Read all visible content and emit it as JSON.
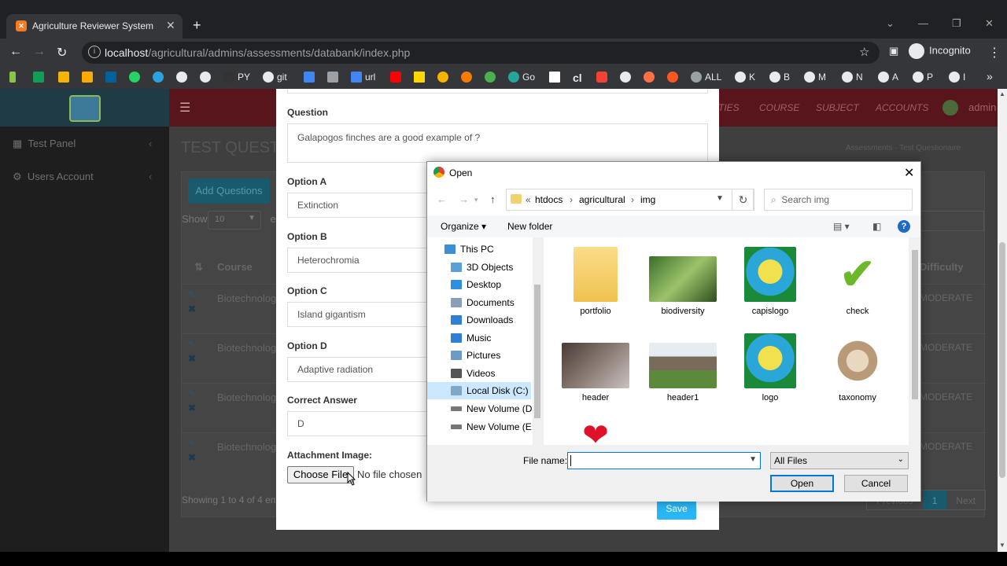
{
  "browser": {
    "tab_title": "Agriculture Reviewer System",
    "new_tab": "+",
    "url_host": "localhost",
    "url_path": "/agricultural/admins/assessments/databank/index.php",
    "incognito_label": "Incognito",
    "bookmarks": [
      "PY",
      "git",
      "url",
      "Go",
      "cl",
      "ALL",
      "K",
      "B",
      "M",
      "N",
      "A",
      "P",
      "I"
    ],
    "more_bookmarks": "»"
  },
  "sidebar": {
    "items": [
      {
        "label": "Test Panel"
      },
      {
        "label": "Users Account"
      }
    ]
  },
  "topnav": {
    "items": [
      "TIES",
      "COURSE",
      "SUBJECT",
      "ACCOUNTS"
    ],
    "user": "admin"
  },
  "content": {
    "title": "TEST QUESTI",
    "breadcrumb": "Assessments  ·  Test Questionaire",
    "add_button": "Add Questions",
    "show_label": "Show",
    "entries_value": "10",
    "entries_suffix": "en",
    "columns": {
      "course": "Course",
      "difficulty": "Difficulty"
    },
    "rows": [
      {
        "course": "Biotechnolog",
        "difficulty": "MODERATE"
      },
      {
        "course": "Biotechnolog",
        "difficulty": "MODERATE"
      },
      {
        "course": "Biotechnolog",
        "difficulty": "MODERATE"
      },
      {
        "course": "Biotechnolog",
        "difficulty": "MODERATE"
      }
    ],
    "showing": "Showing 1 to 4 of 4 ent",
    "pager": {
      "previous": "Previous",
      "current": "1",
      "next": "Next"
    }
  },
  "modal": {
    "question_label": "Question",
    "question_value": "Galapogos finches are a good example of ?",
    "option_a_label": "Option A",
    "option_a_value": "Extinction",
    "option_b_label": "Option B",
    "option_b_value": "Heterochromia",
    "option_c_label": "Option C",
    "option_c_value": "Island gigantism",
    "option_d_label": "Option D",
    "option_d_value": "Adaptive radiation",
    "answer_label": "Correct Answer",
    "answer_value": "D",
    "attachment_label": "Attachment Image:",
    "choose_file": "Choose File",
    "no_file": "No file chosen",
    "save": "Save"
  },
  "dialog": {
    "title": "Open",
    "path": [
      "«",
      "htdocs",
      "›",
      "agricultural",
      "›",
      "img"
    ],
    "search_placeholder": "Search img",
    "organize": "Organize ▾",
    "new_folder": "New folder",
    "nav_items": [
      {
        "label": "This PC"
      },
      {
        "label": "3D Objects"
      },
      {
        "label": "Desktop"
      },
      {
        "label": "Documents"
      },
      {
        "label": "Downloads"
      },
      {
        "label": "Music"
      },
      {
        "label": "Pictures"
      },
      {
        "label": "Videos"
      },
      {
        "label": "Local Disk (C:)"
      },
      {
        "label": "New Volume (D:)"
      },
      {
        "label": "New Volume (E:)"
      }
    ],
    "files": [
      {
        "name": "portfolio"
      },
      {
        "name": "biodiversity"
      },
      {
        "name": "capislogo"
      },
      {
        "name": "check"
      },
      {
        "name": "header"
      },
      {
        "name": "header1"
      },
      {
        "name": "logo"
      },
      {
        "name": "taxonomy"
      }
    ],
    "file_name_label": "File name:",
    "file_name_value": "",
    "file_type": "All Files",
    "open": "Open",
    "cancel": "Cancel"
  }
}
